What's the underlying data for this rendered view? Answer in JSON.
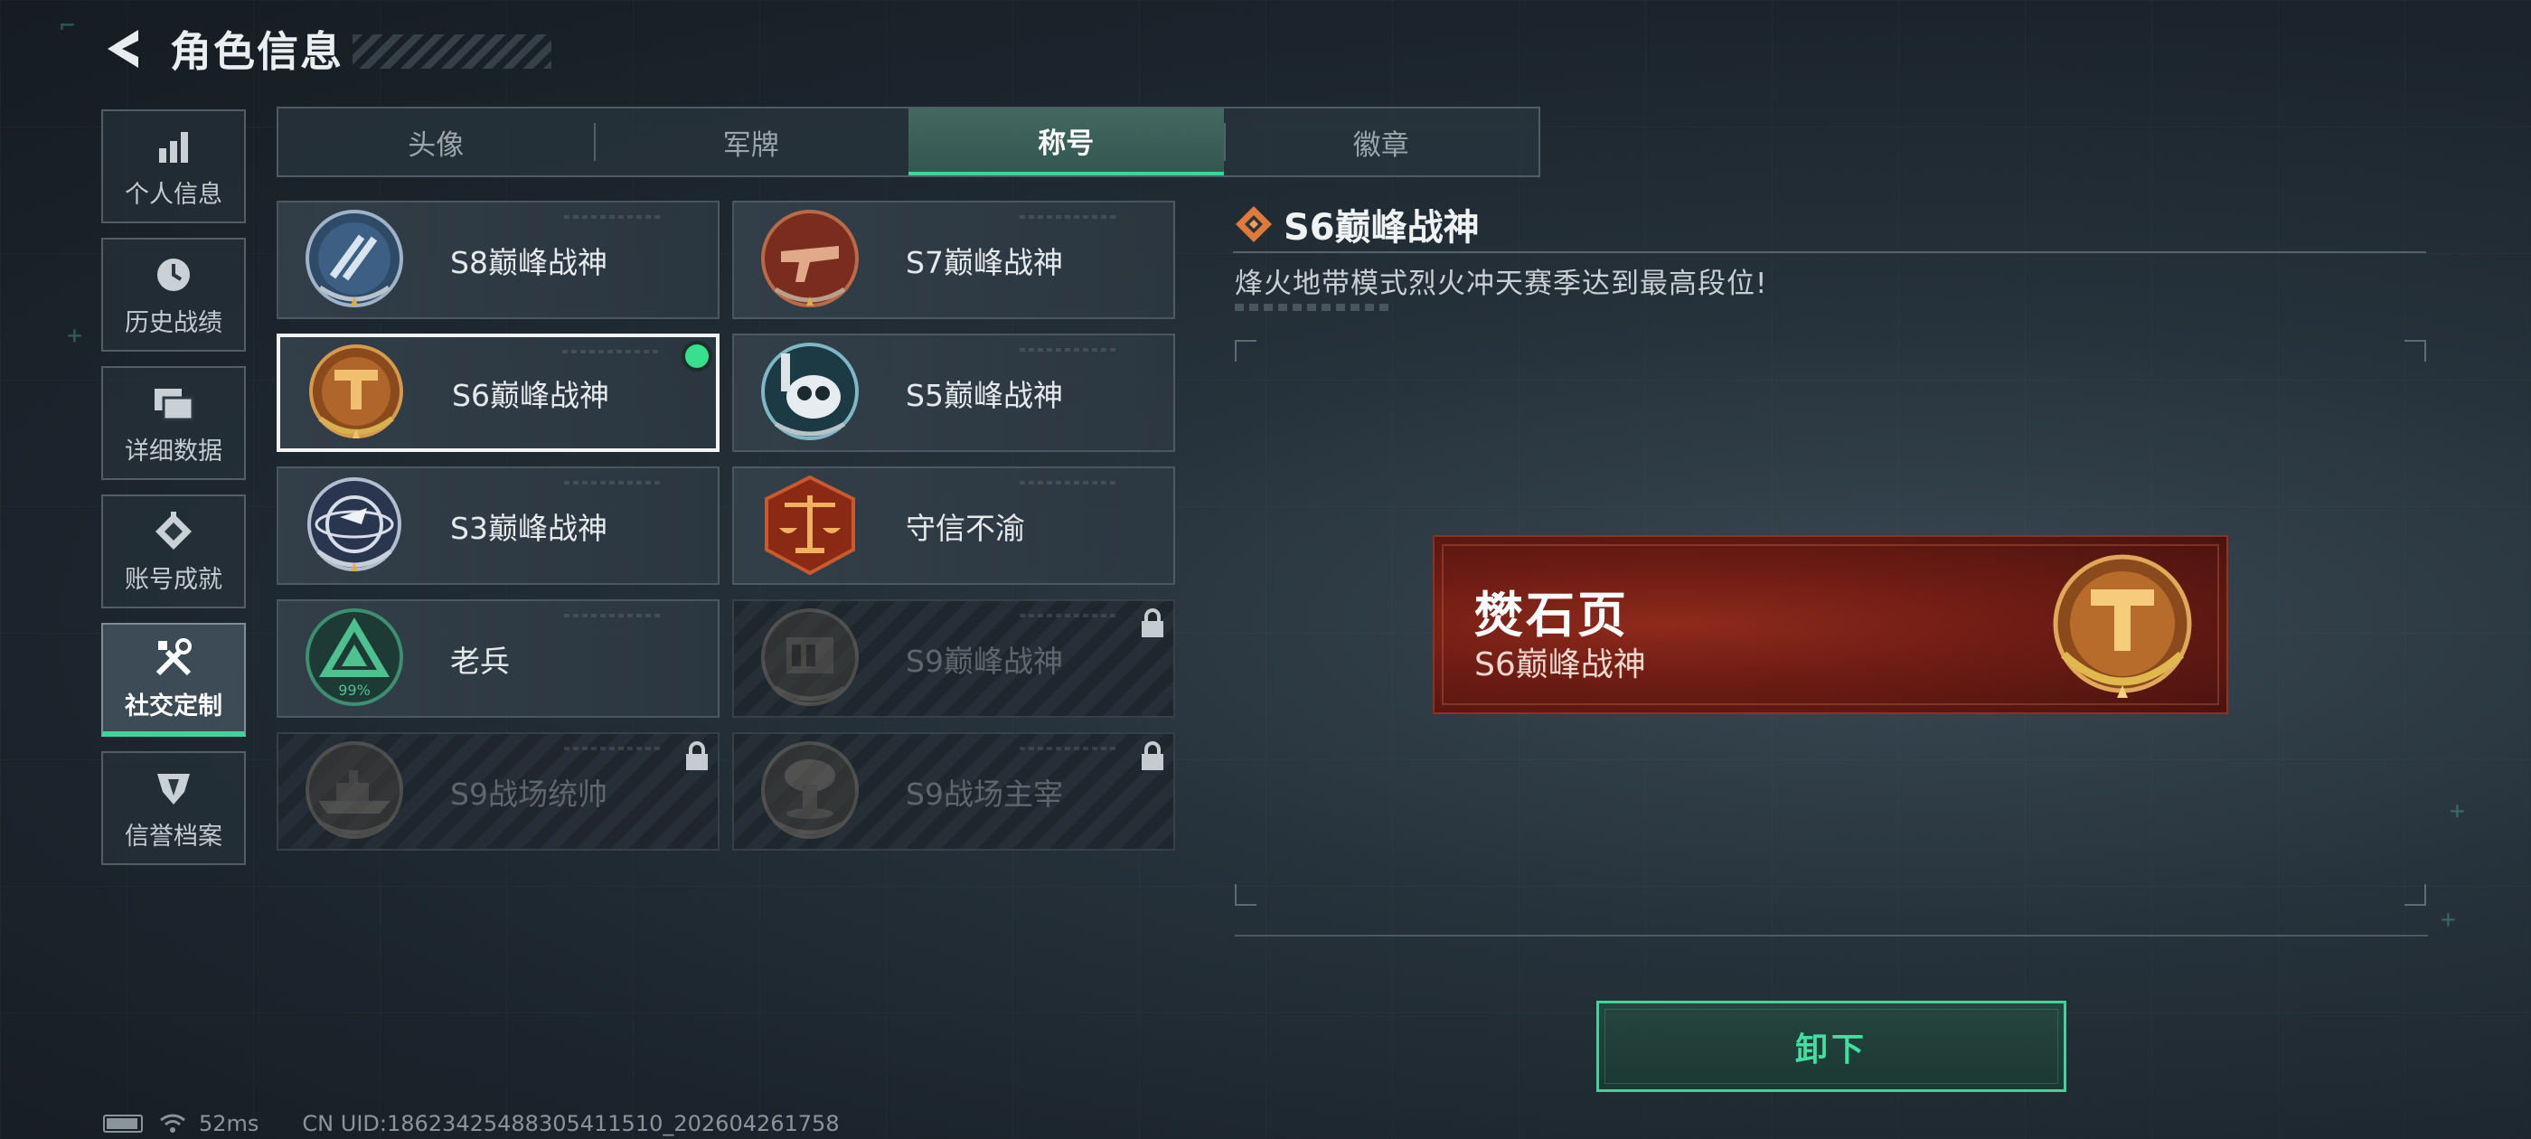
{
  "header": {
    "title": "角色信息"
  },
  "sidebar": {
    "items": [
      {
        "label": "个人信息",
        "icon": "bar-chart-icon",
        "active": false
      },
      {
        "label": "历史战绩",
        "icon": "clock-icon",
        "active": false
      },
      {
        "label": "详细数据",
        "icon": "folder-icon",
        "active": false
      },
      {
        "label": "账号成就",
        "icon": "achievement-icon",
        "active": false
      },
      {
        "label": "社交定制",
        "icon": "tools-icon",
        "active": true
      },
      {
        "label": "信誉档案",
        "icon": "shield-icon",
        "active": false
      }
    ]
  },
  "tabs": [
    {
      "label": "头像",
      "active": false
    },
    {
      "label": "军牌",
      "active": false
    },
    {
      "label": "称号",
      "active": true
    },
    {
      "label": "徽章",
      "active": false
    }
  ],
  "titles": [
    {
      "label": "S8巅峰战神",
      "badge": "s8-badge-icon",
      "locked": false,
      "selected": false
    },
    {
      "label": "S7巅峰战神",
      "badge": "s7-badge-icon",
      "locked": false,
      "selected": false
    },
    {
      "label": "S6巅峰战神",
      "badge": "s6-badge-icon",
      "locked": false,
      "selected": true
    },
    {
      "label": "S5巅峰战神",
      "badge": "s5-badge-icon",
      "locked": false,
      "selected": false
    },
    {
      "label": "S3巅峰战神",
      "badge": "s3-badge-icon",
      "locked": false,
      "selected": false
    },
    {
      "label": "守信不渝",
      "badge": "scales-badge-icon",
      "locked": false,
      "selected": false
    },
    {
      "label": "老兵",
      "badge": "veteran-badge-icon",
      "locked": false,
      "selected": false,
      "badge_text": "99%"
    },
    {
      "label": "S9巅峰战神",
      "badge": "s9-badge-icon",
      "locked": true,
      "selected": false
    },
    {
      "label": "S9战场统帅",
      "badge": "warship-badge-icon",
      "locked": true,
      "selected": false
    },
    {
      "label": "S9战场主宰",
      "badge": "mushroom-cloud-badge-icon",
      "locked": true,
      "selected": false
    }
  ],
  "detail": {
    "title": "S6巅峰战神",
    "description": "烽火地带模式烈火冲天赛季达到最高段位!",
    "preview": {
      "player_name": "燓石页",
      "title": "S6巅峰战神"
    },
    "action_label": "卸下"
  },
  "status_bar": {
    "ping": "52ms",
    "uid": "CN UID:1862342548830541151​0_202604261758"
  },
  "colors": {
    "accent_green": "#3fd49a",
    "equipped_dot": "#36e08f",
    "preview_red": "#8f2a1c",
    "badge_gold": "#c9923e"
  }
}
